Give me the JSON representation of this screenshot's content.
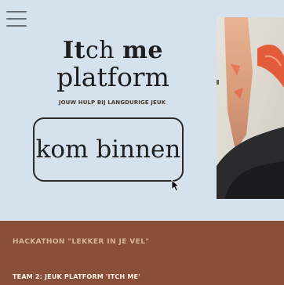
{
  "header": {
    "menu_icon": "hamburger-menu-icon"
  },
  "logo": {
    "itch_bold": "It",
    "itch_rest": "ch",
    "me": "me",
    "platform": "platform"
  },
  "tagline": "JOUW HULP BIJ LANGDURIGE JEUK",
  "cta": {
    "label": "kom binnen",
    "cursor_icon": "arrow-cursor-icon"
  },
  "footer": {
    "hackathon": "HACKATHON \"LEKKER IN JE VEL\"",
    "team": "TEAM 2: JEUK PLATFORM 'ITCH ME'"
  },
  "colors": {
    "background": "#d6e1ee",
    "footer": "#8a4f39",
    "footer_accent": "#d9b48f"
  }
}
